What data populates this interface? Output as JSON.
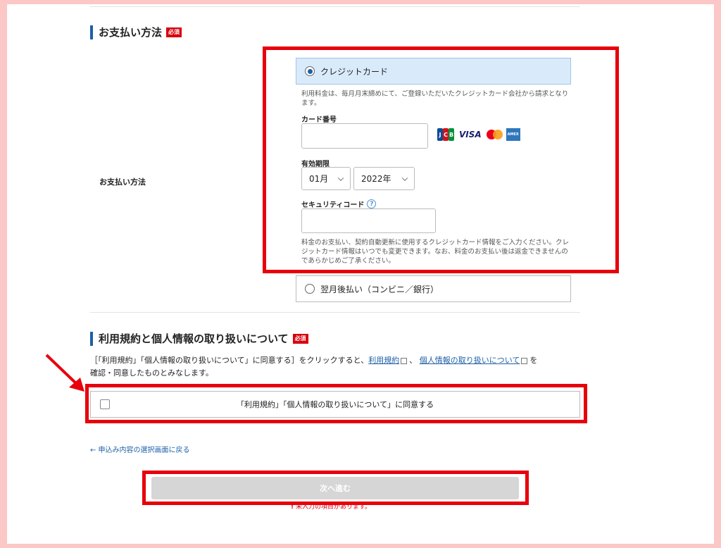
{
  "payment_section": {
    "title": "お支払い方法",
    "required_badge": "必須",
    "row_label": "お支払い方法"
  },
  "credit_card": {
    "option_label": "クレジットカード",
    "selected": true,
    "note": "利用料金は、毎月月末締めにて、ご登録いただいたクレジットカード会社から請求となります。",
    "card_number_label": "カード番号",
    "card_number_value": "",
    "card_brands": [
      "JCB",
      "VISA",
      "Mastercard",
      "American Express"
    ],
    "visa_text": "VISA",
    "jcb_letters": [
      "J",
      "C",
      "B"
    ],
    "amex_text": "AMEX",
    "expiry_label": "有効期限",
    "expiry_month": "01月",
    "expiry_year": "2022年",
    "security_code_label": "セキュリティコード",
    "help_mark": "?",
    "security_code_value": "",
    "security_note": "料金のお支払い、契約自動更新に使用するクレジットカード情報をご入力ください。クレジットカード情報はいつでも変更できます。なお、料金のお支払い後は返金できませんのであらかじめご了承ください。"
  },
  "deferred_payment": {
    "option_label": "翌月後払い（コンビニ／銀行）",
    "selected": false
  },
  "terms_section": {
    "title": "利用規約と個人情報の取り扱いについて",
    "required_badge": "必須",
    "text_prefix": "［「利用規約」「個人情報の取り扱いについて」に同意する］をクリックすると、",
    "link_terms": "利用規約",
    "separator": "、",
    "link_privacy": "個人情報の取り扱いについて",
    "text_suffix_1": "を",
    "text_suffix_2": "確認・同意したものとみなします。",
    "agree_label": "「利用規約」「個人情報の取り扱いについて」に同意する",
    "agree_checked": false
  },
  "navigation": {
    "back_link": "← 申込み内容の選択画面に戻る",
    "next_button": "次へ進む",
    "warning": "未入力の項目があります。"
  },
  "colors": {
    "highlight_frame": "#e8000b",
    "accent": "#1d5fa8",
    "selected_option_bg": "#d9ebfb",
    "page_border": "#fbc7c7"
  }
}
